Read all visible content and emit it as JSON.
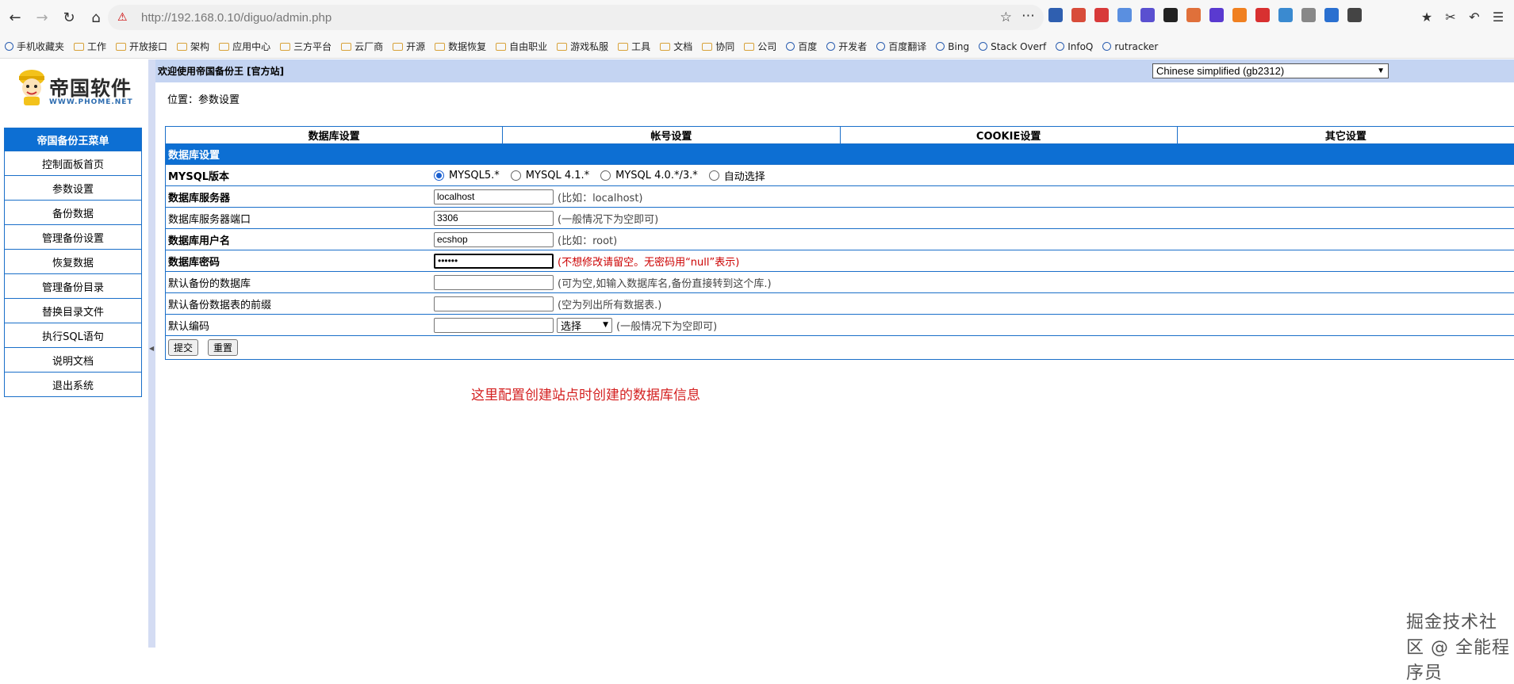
{
  "browser": {
    "url": "http://192.168.0.10/diguo/admin.php",
    "extension_colors": [
      "#2f5fb0",
      "#d84c3a",
      "#d83a3a",
      "#5a8fe0",
      "#5a50d0",
      "#222222",
      "#e0703a",
      "#5a3ad0",
      "#f08020",
      "#d83030",
      "#3a8ad0",
      "#888888",
      "#2a70d0",
      "#444444"
    ],
    "bookmarks": [
      {
        "label": "手机收藏夹",
        "icon": "mobile-icon"
      },
      {
        "label": "工作",
        "icon": "folder-icon"
      },
      {
        "label": "开放接口",
        "icon": "folder-icon"
      },
      {
        "label": "架构",
        "icon": "folder-icon"
      },
      {
        "label": "应用中心",
        "icon": "folder-icon"
      },
      {
        "label": "三方平台",
        "icon": "folder-icon"
      },
      {
        "label": "云厂商",
        "icon": "folder-icon"
      },
      {
        "label": "开源",
        "icon": "folder-icon"
      },
      {
        "label": "数据恢复",
        "icon": "folder-icon"
      },
      {
        "label": "自由职业",
        "icon": "folder-icon"
      },
      {
        "label": "游戏私服",
        "icon": "folder-icon"
      },
      {
        "label": "工具",
        "icon": "folder-icon"
      },
      {
        "label": "文档",
        "icon": "folder-icon"
      },
      {
        "label": "协同",
        "icon": "folder-icon"
      },
      {
        "label": "公司",
        "icon": "folder-icon"
      },
      {
        "label": "百度",
        "icon": "baidu-icon"
      },
      {
        "label": "开发者",
        "icon": "dev-icon"
      },
      {
        "label": "百度翻译",
        "icon": "translate-icon"
      },
      {
        "label": "Bing",
        "icon": "bing-icon"
      },
      {
        "label": "Stack Overf",
        "icon": "stackoverflow-icon"
      },
      {
        "label": "InfoQ",
        "icon": "infoq-icon"
      },
      {
        "label": "rutracker",
        "icon": "rutracker-icon"
      }
    ]
  },
  "logo": {
    "title": "帝国软件",
    "subtitle": "WWW.PHOME.NET"
  },
  "menu": {
    "header": "帝国备份王菜单",
    "items": [
      "控制面板首页",
      "参数设置",
      "备份数据",
      "管理备份设置",
      "恢复数据",
      "管理备份目录",
      "替换目录文件",
      "执行SQL语句",
      "说明文档",
      "退出系统"
    ]
  },
  "topbar": {
    "welcome": "欢迎使用帝国备份王 [官方站]",
    "language": "Chinese simplified (gb2312)"
  },
  "location": "位置：参数设置",
  "tabs": [
    "数据库设置",
    "帐号设置",
    "COOKIE设置",
    "其它设置"
  ],
  "form": {
    "section": "数据库设置",
    "mysql_version": {
      "label": "MYSQL版本",
      "options": [
        "MYSQL5.*",
        "MYSQL 4.1.*",
        "MYSQL 4.0.*/3.*",
        "自动选择"
      ],
      "selected": 0
    },
    "server": {
      "label": "数据库服务器",
      "value": "localhost",
      "hint": "(比如：localhost)"
    },
    "port": {
      "label": "数据库服务器端口",
      "value": "3306",
      "hint": "(一般情况下为空即可)"
    },
    "username": {
      "label": "数据库用户名",
      "value": "ecshop",
      "hint": "(比如：root)"
    },
    "password": {
      "label": "数据库密码",
      "value": "••••••",
      "hint": "(不想修改请留空。无密码用“null”表示)"
    },
    "default_db": {
      "label": "默认备份的数据库",
      "value": "",
      "hint": "(可为空,如输入数据库名,备份直接转到这个库.)"
    },
    "table_prefix": {
      "label": "默认备份数据表的前缀",
      "value": "",
      "hint": "(空为列出所有数据表.)"
    },
    "charset": {
      "label": "默认编码",
      "value": "",
      "select_value": "选择",
      "hint": "(一般情况下为空即可)"
    },
    "submit": "提交",
    "reset": "重置"
  },
  "annotation": "这里配置创建站点时创建的数据库信息",
  "watermark": "掘金技术社区 @ 全能程序员"
}
